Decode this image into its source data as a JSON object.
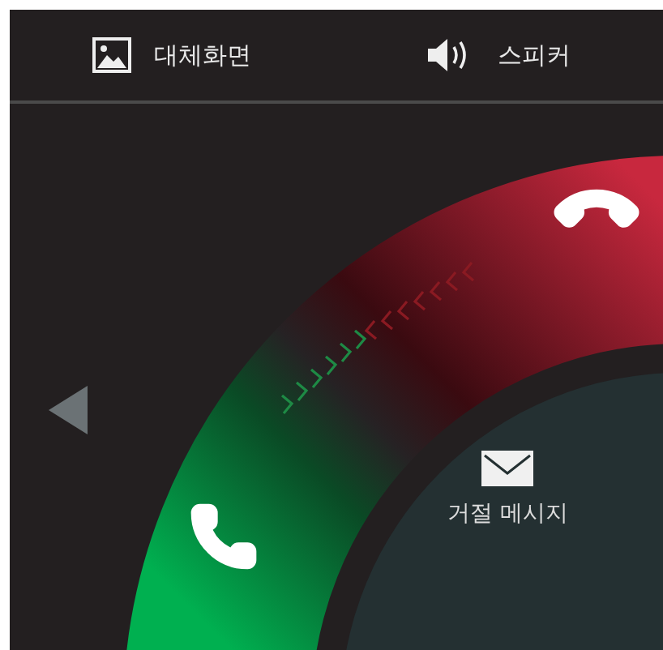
{
  "top_bar": {
    "items": [
      {
        "kind": "image",
        "label": "대체화면"
      },
      {
        "kind": "speaker",
        "label": "스피커"
      }
    ]
  },
  "reject_message": {
    "label": "거절 메시지"
  }
}
